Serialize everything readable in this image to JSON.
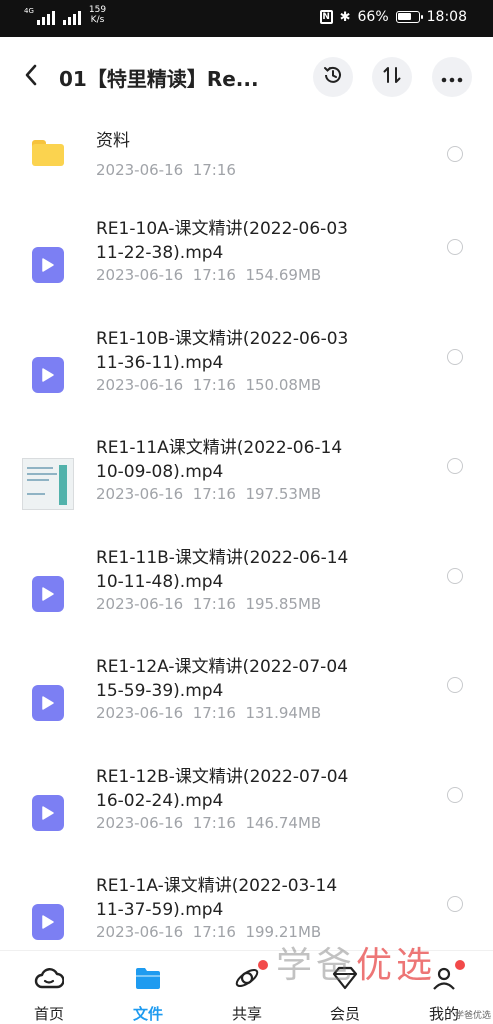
{
  "status_bar": {
    "signal1_tag": "4G",
    "signal2_tag": "",
    "speed": "159\nK/s",
    "battery": "66%",
    "battery_level": 0.66,
    "time": "18:08"
  },
  "header": {
    "back_icon": "chevron-left-icon",
    "title": "01【特里精读】Re...",
    "history_icon": "history-icon",
    "sort_icon": "sort-icon",
    "more_icon": "more-icon"
  },
  "files": [
    {
      "type": "folder",
      "name": "资料",
      "date": "2023-06-16",
      "time": "17:16",
      "size": ""
    },
    {
      "type": "video",
      "name": "RE1-10A-课文精讲(2022-06-03\n11-22-38).mp4",
      "date": "2023-06-16",
      "time": "17:16",
      "size": "154.69MB"
    },
    {
      "type": "video",
      "name": "RE1-10B-课文精讲(2022-06-03\n11-36-11).mp4",
      "date": "2023-06-16",
      "time": "17:16",
      "size": "150.08MB"
    },
    {
      "type": "thumbnail",
      "name": "RE1-11A课文精讲(2022-06-14\n10-09-08).mp4",
      "date": "2023-06-16",
      "time": "17:16",
      "size": "197.53MB"
    },
    {
      "type": "video",
      "name": "RE1-11B-课文精讲(2022-06-14\n10-11-48).mp4",
      "date": "2023-06-16",
      "time": "17:16",
      "size": "195.85MB"
    },
    {
      "type": "video",
      "name": "RE1-12A-课文精讲(2022-07-04\n15-59-39).mp4",
      "date": "2023-06-16",
      "time": "17:16",
      "size": "131.94MB"
    },
    {
      "type": "video",
      "name": "RE1-12B-课文精讲(2022-07-04\n16-02-24).mp4",
      "date": "2023-06-16",
      "time": "17:16",
      "size": "146.74MB"
    },
    {
      "type": "video",
      "name": "RE1-1A-课文精讲(2022-03-14\n11-37-59).mp4",
      "date": "2023-06-16",
      "time": "17:16",
      "size": "199.21MB"
    }
  ],
  "bottom_nav": [
    {
      "label": "首页",
      "icon": "cloud-home-icon",
      "active": false
    },
    {
      "label": "文件",
      "icon": "folder-icon",
      "active": true
    },
    {
      "label": "共享",
      "icon": "share-orbit-icon",
      "active": false,
      "badge": true
    },
    {
      "label": "会员",
      "icon": "diamond-icon",
      "active": false
    },
    {
      "label": "我的",
      "icon": "profile-icon",
      "active": false,
      "badge": true
    }
  ],
  "watermark": {
    "text_a": "学爸",
    "text_b": "优选",
    "small": "学爸优选"
  },
  "colors": {
    "accent": "#1e9bf0",
    "video_icon": "#7c7ff3",
    "folder": "#fbd34f",
    "meta_text": "#a0a3a8"
  }
}
